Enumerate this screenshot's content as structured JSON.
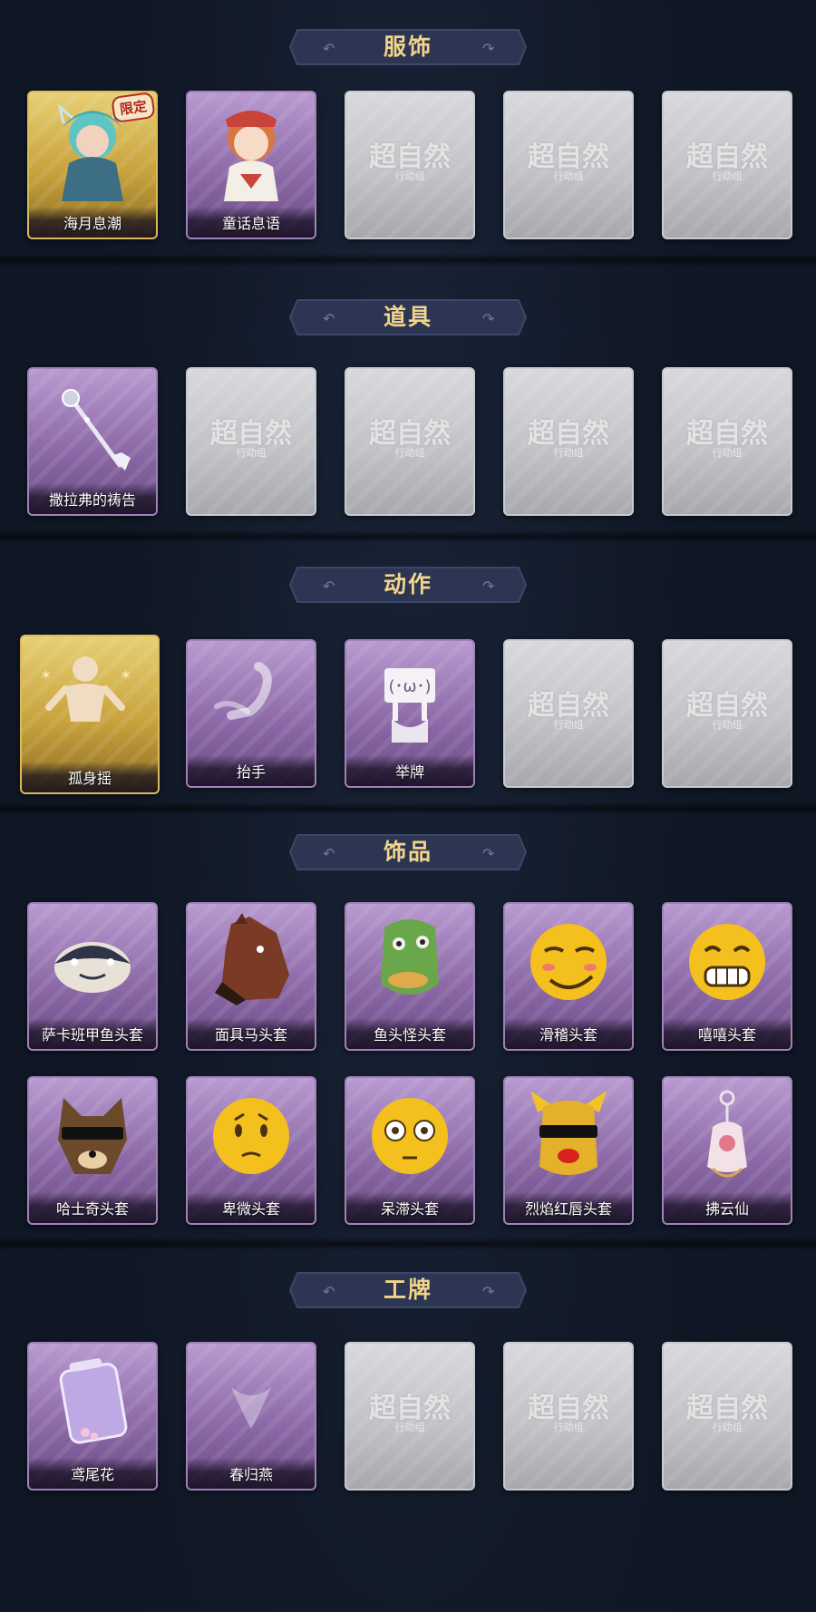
{
  "placeholder": {
    "main": "超自然",
    "sub": "行动组"
  },
  "sections": [
    {
      "title": "服饰",
      "cards": [
        {
          "rarity": "gold",
          "label": "海月息潮",
          "badge": "限定",
          "icon": "character-portrait-icon"
        },
        {
          "rarity": "purple",
          "label": "童话息语",
          "icon": "character-portrait-icon"
        },
        {
          "rarity": "empty"
        },
        {
          "rarity": "empty"
        },
        {
          "rarity": "empty"
        }
      ]
    },
    {
      "title": "道具",
      "cards": [
        {
          "rarity": "purple",
          "label": "撒拉弗的祷告",
          "icon": "trident-staff-icon"
        },
        {
          "rarity": "empty"
        },
        {
          "rarity": "empty"
        },
        {
          "rarity": "empty"
        },
        {
          "rarity": "empty"
        }
      ]
    },
    {
      "title": "动作",
      "cards": [
        {
          "rarity": "gold",
          "label": "孤身摇",
          "icon": "dancing-figure-icon"
        },
        {
          "rarity": "purple",
          "label": "抬手",
          "icon": "raising-hand-icon"
        },
        {
          "rarity": "purple",
          "label": "举牌",
          "icon": "holding-sign-icon"
        },
        {
          "rarity": "empty"
        },
        {
          "rarity": "empty"
        }
      ]
    },
    {
      "title": "饰品",
      "cards": [
        {
          "rarity": "purple",
          "label": "萨卡班甲鱼头套",
          "icon": "fish-head-mask-icon"
        },
        {
          "rarity": "purple",
          "label": "面具马头套",
          "icon": "horse-head-mask-icon"
        },
        {
          "rarity": "purple",
          "label": "鱼头怪头套",
          "icon": "fish-monster-mask-icon"
        },
        {
          "rarity": "purple",
          "label": "滑稽头套",
          "icon": "funny-face-mask-icon"
        },
        {
          "rarity": "purple",
          "label": "嘻嘻头套",
          "icon": "grin-face-mask-icon"
        },
        {
          "rarity": "purple",
          "label": "哈士奇头套",
          "icon": "husky-mask-icon"
        },
        {
          "rarity": "purple",
          "label": "卑微头套",
          "icon": "humble-face-mask-icon"
        },
        {
          "rarity": "purple",
          "label": "呆滞头套",
          "icon": "dazed-face-mask-icon"
        },
        {
          "rarity": "purple",
          "label": "烈焰红唇头套",
          "icon": "red-lips-mask-icon"
        },
        {
          "rarity": "purple",
          "label": "拂云仙",
          "icon": "pendant-charm-icon"
        }
      ]
    },
    {
      "title": "工牌",
      "cards": [
        {
          "rarity": "purple",
          "label": "鸢尾花",
          "icon": "badge-card-icon"
        },
        {
          "rarity": "purple",
          "label": "春归燕",
          "icon": "swallow-badge-icon"
        },
        {
          "rarity": "empty"
        },
        {
          "rarity": "empty"
        },
        {
          "rarity": "empty"
        }
      ]
    }
  ]
}
